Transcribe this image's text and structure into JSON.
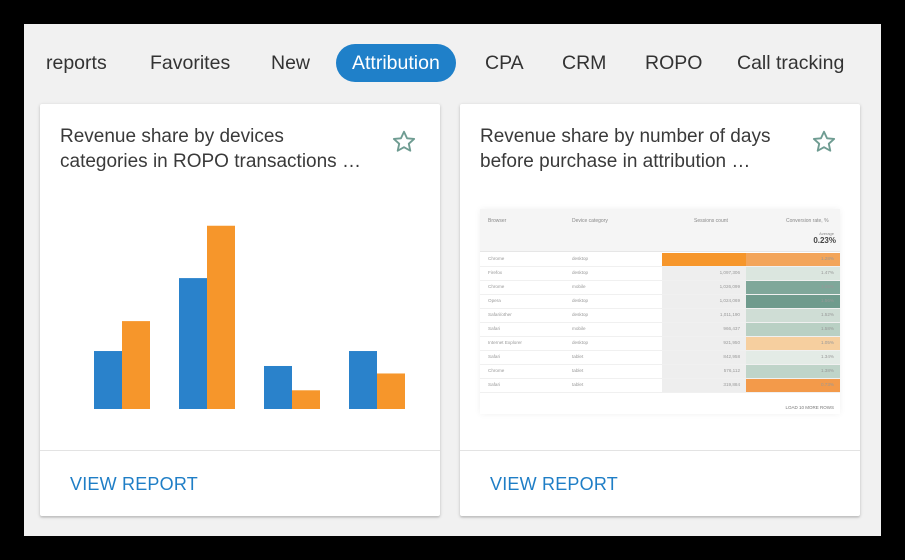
{
  "tabs": [
    {
      "label": "reports",
      "active": false
    },
    {
      "label": "Favorites",
      "active": false
    },
    {
      "label": "New",
      "active": false
    },
    {
      "label": "Attribution",
      "active": true
    },
    {
      "label": "CPA",
      "active": false
    },
    {
      "label": "CRM",
      "active": false
    },
    {
      "label": "ROPO",
      "active": false
    },
    {
      "label": "Call tracking",
      "active": false
    }
  ],
  "colors": {
    "accent": "#1f80c9",
    "bar_blue": "#2a82cb",
    "bar_orange": "#f6962b",
    "link": "#1f7ec6"
  },
  "cards": [
    {
      "title": "Revenue share by devices categories in ROPO transactions …",
      "action": "VIEW REPORT",
      "star_icon": "star-outline-icon"
    },
    {
      "title": "Revenue share by number of days before purchase in attribution …",
      "action": "VIEW REPORT",
      "star_icon": "star-outline-icon"
    }
  ],
  "chart_data": {
    "type": "bar",
    "categories": [
      "",
      "",
      "",
      ""
    ],
    "series": [
      {
        "color": "#2a82cb",
        "values": [
          31,
          70,
          23,
          31
        ]
      },
      {
        "color": "#f6962b",
        "values": [
          47,
          98,
          10,
          19
        ]
      }
    ],
    "ylim": [
      0,
      100
    ],
    "title": "",
    "xlabel": "",
    "ylabel": ""
  },
  "thumbnail": {
    "headers": [
      "Browser",
      "Device category",
      "Sessions count",
      "Conversion rate, %"
    ],
    "average_label": "Average",
    "average_value": "0.23%",
    "rows": [
      {
        "browser": "Chrome",
        "device": "desktop",
        "sessions": "",
        "rate": "1.28%",
        "bar": 1.0,
        "rate_level": 0.4,
        "rate_color": "#f3a55a"
      },
      {
        "browser": "Firefox",
        "device": "desktop",
        "sessions": "1,097,306",
        "rate": "1.47%",
        "bar": 0.0,
        "rate_level": 0.15,
        "rate_color": "#dbe6df"
      },
      {
        "browser": "Chrome",
        "device": "mobile",
        "sessions": "1,026,099",
        "rate": "1.55%",
        "bar": 0.0,
        "rate_level": 0.9,
        "rate_color": "#7fa79a"
      },
      {
        "browser": "Opera",
        "device": "desktop",
        "sessions": "1,024,069",
        "rate": "1.56%",
        "bar": 0.0,
        "rate_level": 1.0,
        "rate_color": "#6f9b8d"
      },
      {
        "browser": "Safari/other",
        "device": "desktop",
        "sessions": "1,011,190",
        "rate": "1.52%",
        "bar": 0.0,
        "rate_level": 0.3,
        "rate_color": "#cfddd5"
      },
      {
        "browser": "Safari",
        "device": "mobile",
        "sessions": "966,437",
        "rate": "1.58%",
        "bar": 0.0,
        "rate_level": 0.5,
        "rate_color": "#b9d0c4"
      },
      {
        "browser": "Internet Explorer",
        "device": "desktop",
        "sessions": "921,950",
        "rate": "1.05%",
        "bar": 0.0,
        "rate_level": 0.3,
        "rate_color": "#f6cf9f"
      },
      {
        "browser": "Safari",
        "device": "tablet",
        "sessions": "842,958",
        "rate": "1.34%",
        "bar": 0.0,
        "rate_level": 0.2,
        "rate_color": "#e3ebe6"
      },
      {
        "browser": "Chrome",
        "device": "tablet",
        "sessions": "576,112",
        "rate": "1.38%",
        "bar": 0.0,
        "rate_level": 0.45,
        "rate_color": "#bfd4c9"
      },
      {
        "browser": "Safari",
        "device": "tablet",
        "sessions": "319,884",
        "rate": "0.73%",
        "bar": 0.0,
        "rate_level": 0.9,
        "rate_color": "#f39a4a"
      }
    ],
    "footer": "LOAD 10 MORE ROWS"
  }
}
